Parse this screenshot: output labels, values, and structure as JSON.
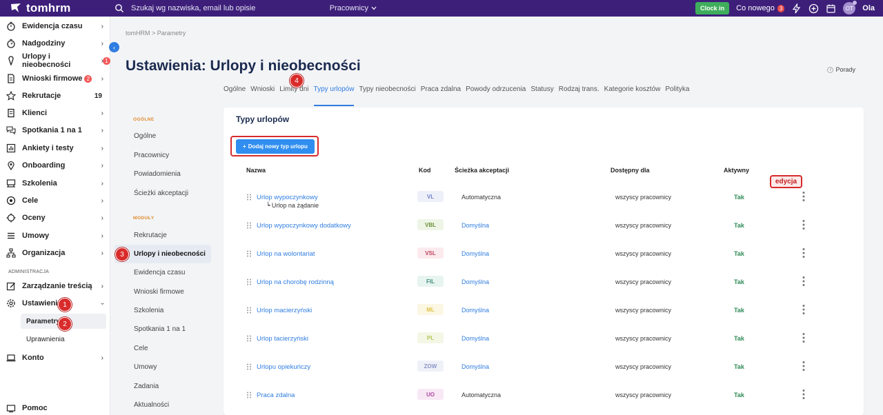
{
  "topbar": {
    "brand": "tomhrm",
    "search_placeholder": "Szukaj wg nazwiska, email lub opisie",
    "search_scope": "Pracownicy",
    "clock_in": "Clock in",
    "co_nowego": "Co nowego",
    "co_nowego_count": "3",
    "avatar_initials": "OT",
    "username": "Ola"
  },
  "sidebar": {
    "items": [
      {
        "label": "Ewidencja czasu",
        "icon": "stopwatch-icon"
      },
      {
        "label": "Nadgodziny",
        "icon": "stopwatch-icon"
      },
      {
        "label": "Urlopy i nieobecności",
        "icon": "map-pin-icon",
        "badge": "1"
      },
      {
        "label": "Wnioski firmowe",
        "icon": "document-icon",
        "badge": "2"
      },
      {
        "label": "Rekrutacje",
        "icon": "star-icon",
        "count": "19"
      },
      {
        "label": "Klienci",
        "icon": "building-icon"
      },
      {
        "label": "Spotkania 1 na 1",
        "icon": "chat-icon"
      },
      {
        "label": "Ankiety i testy",
        "icon": "chart-icon"
      },
      {
        "label": "Onboarding",
        "icon": "location-icon"
      },
      {
        "label": "Szkolenia",
        "icon": "training-icon"
      },
      {
        "label": "Cele",
        "icon": "target-icon"
      },
      {
        "label": "Oceny",
        "icon": "rating-icon"
      },
      {
        "label": "Umowy",
        "icon": "hamburger-icon"
      },
      {
        "label": "Organizacja",
        "icon": "org-chart-icon"
      }
    ],
    "admin_section": "ADMINISTRACJA",
    "admin_items": [
      {
        "label": "Zarządzanie treścią",
        "icon": "edit-icon"
      },
      {
        "label": "Ustawienia",
        "icon": "gear-icon"
      }
    ],
    "settings_sub": [
      "Parametry",
      "Uprawnienia"
    ],
    "konto": "Konto",
    "pomoc": "Pomoc"
  },
  "steps": [
    "1",
    "2",
    "3",
    "4"
  ],
  "breadcrumb": {
    "root": "tomHRM",
    "sep": ">",
    "current": "Parametry"
  },
  "page_title": "Ustawienia: Urlopy i nieobecności",
  "porady": "Porady",
  "tabs": [
    "Ogólne",
    "Wnioski",
    "Limity dni",
    "Typy urlopów",
    "Typy nieobecności",
    "Praca zdalna",
    "Powody odrzucenia",
    "Statusy",
    "Rodzaj trans.",
    "Kategorie kosztów",
    "Polityka"
  ],
  "subnav": {
    "section_general": "OGÓLNE",
    "general": [
      "Ogólne",
      "Pracownicy",
      "Powiadomienia",
      "Ścieżki akceptacji"
    ],
    "section_modules": "MODUŁY",
    "modules": [
      "Rekrutacje",
      "Urlopy i nieobecności",
      "Ewidencja czasu",
      "Wnioski firmowe",
      "Szkolenia",
      "Spotkania 1 na 1",
      "Cele",
      "Umowy",
      "Zadania",
      "Aktualności"
    ]
  },
  "card": {
    "title": "Typy urlopów",
    "add_button": "Dodaj nowy typ urlopu",
    "columns": [
      "Nazwa",
      "Kod",
      "Ścieżka akceptacji",
      "Dostępny dla",
      "Aktywny"
    ],
    "edit_callout": "edycja",
    "rows": [
      {
        "name": "Urlop wypoczynkowy",
        "sub": "Urlop na żądanie",
        "code": "VL",
        "code_color": "#6f7ec9",
        "code_bg": "#eef0f9",
        "path": "Automatyczna",
        "path_is_link": false,
        "available": "wszyscy pracownicy",
        "active": "Tak"
      },
      {
        "name": "Urlop wypoczynkowy dodatkowy",
        "code": "VBL",
        "code_color": "#6b8f3a",
        "code_bg": "#eef5e6",
        "path": "Domyślna",
        "path_is_link": true,
        "available": "wszyscy pracownicy",
        "active": "Tak"
      },
      {
        "name": "Urlop na wolontariat",
        "code": "VSL",
        "code_color": "#c0455f",
        "code_bg": "#fbeaee",
        "path": "Domyślna",
        "path_is_link": true,
        "available": "wszyscy pracownicy",
        "active": "Tak"
      },
      {
        "name": "Urlop na chorobę rodzinną",
        "code": "FIL",
        "code_color": "#3f8f7c",
        "code_bg": "#e7f4f0",
        "path": "Domyślna",
        "path_is_link": true,
        "available": "wszyscy pracownicy",
        "active": "Tak"
      },
      {
        "name": "Urlop macierzyński",
        "code": "ML",
        "code_color": "#e0c04a",
        "code_bg": "#fcf7e3",
        "path": "Domyślna",
        "path_is_link": true,
        "available": "wszyscy pracownicy",
        "active": "Tak"
      },
      {
        "name": "Urlop tacierzyński",
        "code": "PL",
        "code_color": "#b7c45a",
        "code_bg": "#f5f7e6",
        "path": "Domyślna",
        "path_is_link": true,
        "available": "wszyscy pracownicy",
        "active": "Tak"
      },
      {
        "name": "Urlopu opiekuńczy",
        "code": "ZOW",
        "code_color": "#8a94c6",
        "code_bg": "#eff1f8",
        "path": "Domyślna",
        "path_is_link": true,
        "available": "wszyscy pracownicy",
        "active": "Tak"
      },
      {
        "name": "Praca zdalna",
        "code": "UO",
        "code_color": "#b04ba0",
        "code_bg": "#f8e8f5",
        "path": "Automatyczna",
        "path_is_link": false,
        "available": "wszyscy pracownicy",
        "active": "Tak"
      }
    ]
  },
  "colors": {
    "brand": "#3d1f7a",
    "accent": "#2f7de0",
    "callout": "#d62a2a",
    "active_green": "#2e8b57"
  }
}
